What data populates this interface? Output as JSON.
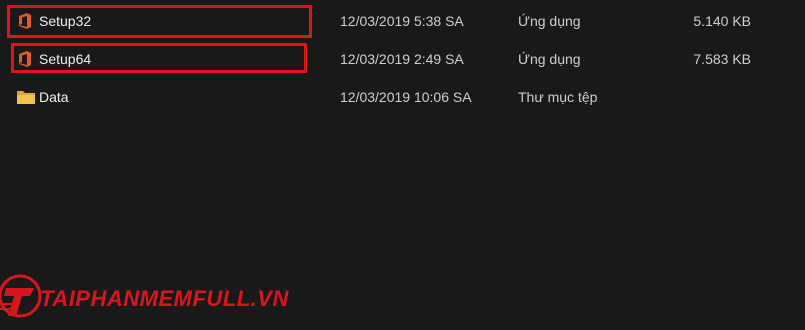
{
  "files": [
    {
      "name": "Setup32",
      "date": "12/03/2019 5:38 SA",
      "type": "Ứng dụng",
      "size": "5.140 KB",
      "icon": "office-icon",
      "highlighted": true
    },
    {
      "name": "Setup64",
      "date": "12/03/2019 2:49 SA",
      "type": "Ứng dụng",
      "size": "7.583 KB",
      "icon": "office-icon",
      "highlighted": true
    },
    {
      "name": "Data",
      "date": "12/03/2019 10:06 SA",
      "type": "Thư mục tệp",
      "size": "",
      "icon": "folder-icon",
      "highlighted": false
    }
  ],
  "watermark": {
    "text": "TAIPHANMEMFULL.VN",
    "color": "#d9161d"
  },
  "colors": {
    "background": "#191919",
    "highlight": "#e0141b",
    "office_orange": "#e8562a",
    "folder_yellow": "#f2c14e"
  }
}
